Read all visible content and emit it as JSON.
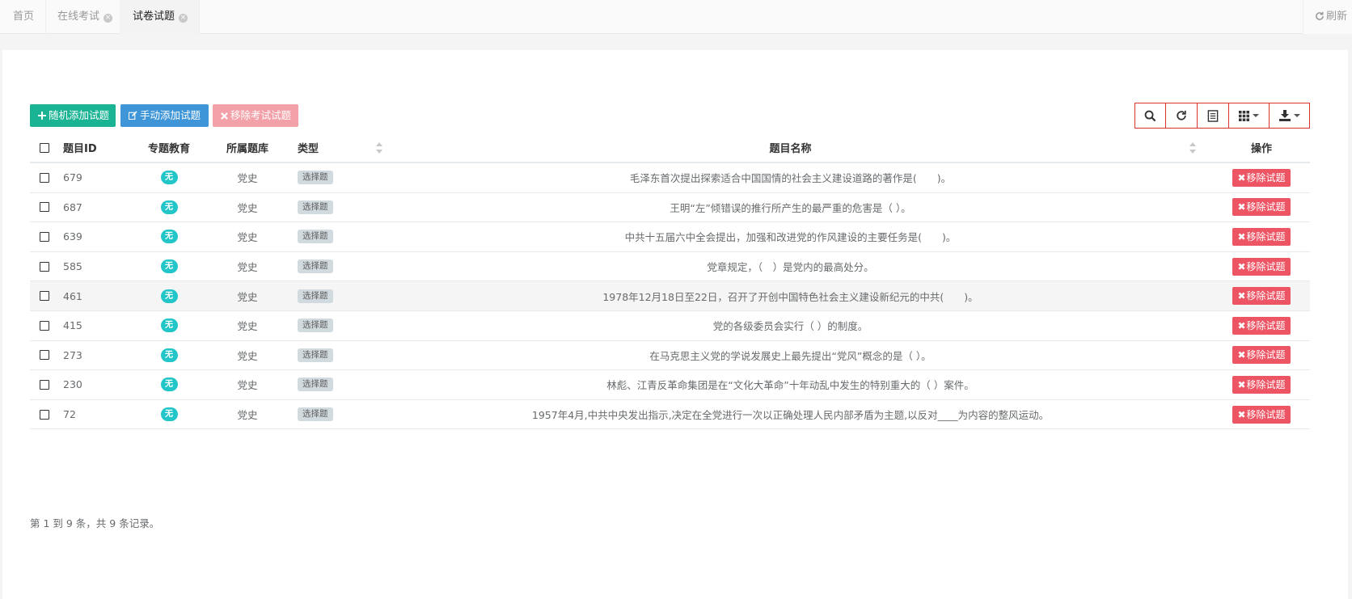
{
  "tabs": [
    {
      "label": "首页",
      "closable": false,
      "active": false
    },
    {
      "label": "在线考试",
      "closable": true,
      "active": false
    },
    {
      "label": "试卷试题",
      "closable": true,
      "active": true
    }
  ],
  "refresh_label": "刷新",
  "toolbar": {
    "random_add": "随机添加试题",
    "manual_add": "手动添加试题",
    "remove_exam": "移除考试试题"
  },
  "table": {
    "headers": {
      "id": "题目ID",
      "topic": "专题教育",
      "bank": "所属题库",
      "type": "类型",
      "name": "题目名称",
      "action": "操作"
    },
    "rows": [
      {
        "id": "679",
        "topic": "无",
        "bank": "党史",
        "type": "选择题",
        "name": "毛泽东首次提出探索适合中国国情的社会主义建设道路的著作是(　　)。",
        "action": "移除试题"
      },
      {
        "id": "687",
        "topic": "无",
        "bank": "党史",
        "type": "选择题",
        "name": "王明“左”倾错误的推行所产生的最严重的危害是（ ）。",
        "action": "移除试题"
      },
      {
        "id": "639",
        "topic": "无",
        "bank": "党史",
        "type": "选择题",
        "name": "中共十五届六中全会提出，加强和改进党的作风建设的主要任务是(　　)。",
        "action": "移除试题"
      },
      {
        "id": "585",
        "topic": "无",
        "bank": "党史",
        "type": "选择题",
        "name": "党章规定，（　）是党内的最高处分。",
        "action": "移除试题"
      },
      {
        "id": "461",
        "topic": "无",
        "bank": "党史",
        "type": "选择题",
        "name": "1978年12月18日至22日，召开了开创中国特色社会主义建设新纪元的中共(　　)。",
        "action": "移除试题"
      },
      {
        "id": "415",
        "topic": "无",
        "bank": "党史",
        "type": "选择题",
        "name": "党的各级委员会实行（ ）的制度。",
        "action": "移除试题"
      },
      {
        "id": "273",
        "topic": "无",
        "bank": "党史",
        "type": "选择题",
        "name": "在马克思主义党的学说发展史上最先提出“党风”概念的是（ ）。",
        "action": "移除试题"
      },
      {
        "id": "230",
        "topic": "无",
        "bank": "党史",
        "type": "选择题",
        "name": "林彪、江青反革命集团是在“文化大革命”十年动乱中发生的特别重大的（ ）案件。",
        "action": "移除试题"
      },
      {
        "id": "72",
        "topic": "无",
        "bank": "党史",
        "type": "选择题",
        "name": "1957年4月,中共中央发出指示,决定在全党进行一次以正确处理人民内部矛盾为主题,以反对____为内容的整风运动。",
        "action": "移除试题"
      }
    ]
  },
  "pagination_text": "第 1 到 9 条，共 9 条记录。",
  "colors": {
    "green": "#1ab394",
    "blue": "#3e95d8",
    "red_light": "#f3a1a8",
    "danger": "#ed5565",
    "cyan_badge": "#23c6c8",
    "tool_border": "#d9342b"
  }
}
